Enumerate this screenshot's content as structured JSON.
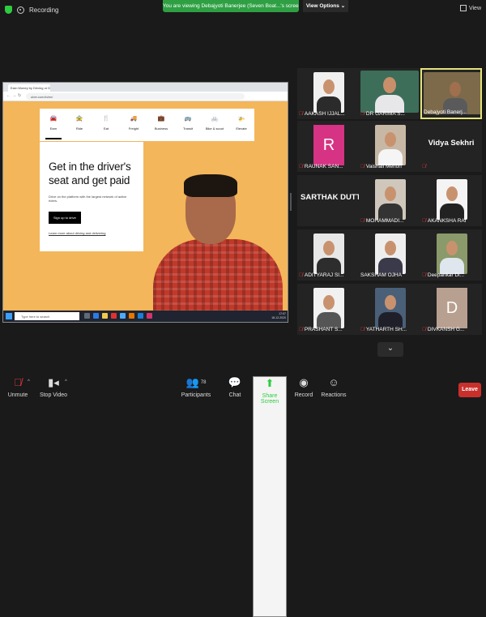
{
  "topbar": {
    "recording_label": "Recording",
    "viewing_banner": "You are viewing Debajyoti Banerjee (Seven Boat...'s screen",
    "view_options_label": "View Options ⌄",
    "view_label": "View"
  },
  "shared_screen": {
    "browser_tab": "Earn Money by Driving or Deli...",
    "url": "uber.com/in/en/",
    "nav_items": [
      "Earn",
      "Ride",
      "Eat",
      "Freight",
      "Business",
      "Transit",
      "Bike & scoot",
      "Elevate"
    ],
    "nav_icons": [
      "car-icon",
      "ride-icon",
      "fork-icon",
      "truck-icon",
      "briefcase-icon",
      "bus-icon",
      "bike-icon",
      "helicopter-icon"
    ],
    "hero_title": "Get in the driver's seat and get paid",
    "hero_subtitle": "Drive on the platform with the largest network of active riders.",
    "signup_label": "Sign up to drive",
    "learn_more": "Learn more about driving and delivering",
    "taskbar_search": "Type here to search",
    "clock_time": "17:07",
    "clock_date": "18-12-2020"
  },
  "participants": [
    {
      "name": "AAKASH IJJAL...",
      "muted": true
    },
    {
      "name": "DR GARIMA S...",
      "muted": true
    },
    {
      "name": "Debajyoti Banerj...",
      "muted": false
    },
    {
      "name": "RAUNAK SAN...",
      "muted": true,
      "initial": "R"
    },
    {
      "name": "Vaishali Menon",
      "muted": true
    },
    {
      "name": "",
      "muted": true,
      "display_name": "Vidya Sekhri"
    },
    {
      "name": "",
      "muted": false,
      "display_name": "SARTHAK DUTT..."
    },
    {
      "name": "MOHAMMADI...",
      "muted": true
    },
    {
      "name": "AKANKSHA RAI",
      "muted": true
    },
    {
      "name": "ADITYARAJ SI...",
      "muted": true
    },
    {
      "name": "SAKSHAM OJHA",
      "muted": false
    },
    {
      "name": "Deepankar Di...",
      "muted": true
    },
    {
      "name": "PRASHANT S...",
      "muted": true
    },
    {
      "name": "YATHARTH SH...",
      "muted": true
    },
    {
      "name": "DIVKANSH G...",
      "muted": true,
      "initial": "D"
    }
  ],
  "toolbar": {
    "unmute": "Unmute",
    "stop_video": "Stop Video",
    "participants": "Participants",
    "participant_count": "78",
    "chat": "Chat",
    "share_screen": "Share Screen",
    "record": "Record",
    "reactions": "Reactions",
    "leave": "Leave"
  }
}
